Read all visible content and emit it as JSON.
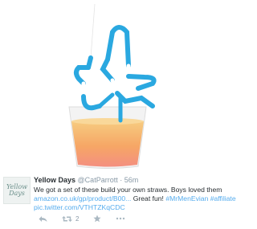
{
  "tweet": {
    "avatar_text_line1": "Yellow",
    "avatar_text_line2": "Days",
    "display_name": "Yellow Days",
    "handle": "@CatParrott",
    "separator": "·",
    "time": "56m",
    "text_line1": "We got a set of these build your own straws. Boys loved them",
    "text_link1": "amazon.co.uk/gp/product/B00...",
    "text_middle": " Great fun! ",
    "text_hashtag1": "#MrMenEvian",
    "text_hashtag2": "#affiliate",
    "text_pic_link": "pic.twitter.com/VTHTZKqCDC"
  },
  "actions": {
    "reply_icon": "reply-icon",
    "retweet_icon": "retweet-icon",
    "retweet_count": "2",
    "favorite_icon": "star-icon",
    "more_icon": "more-dots-icon"
  },
  "colors": {
    "link": "#55acee",
    "text": "#292f33",
    "muted": "#8899a6",
    "straw_blue": "#2aa8e0",
    "juice_orange": "#f6a65a"
  }
}
